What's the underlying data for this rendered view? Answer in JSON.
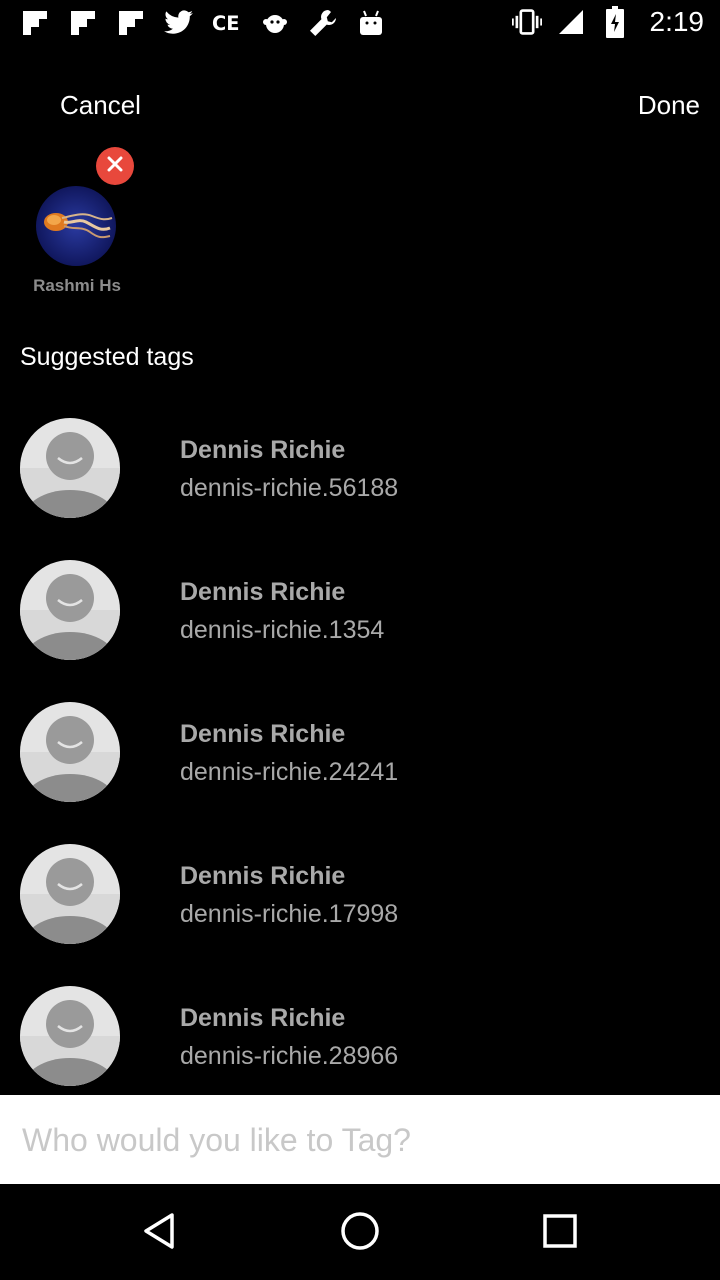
{
  "status_bar": {
    "time": "2:19",
    "left_icons": [
      "flipboard-icon",
      "flipboard-icon",
      "flipboard-icon",
      "twitter-icon",
      "ce-icon",
      "monkey-icon",
      "wrench-icon",
      "android-icon"
    ],
    "right_icons": [
      "vibrate-icon",
      "signal-icon",
      "battery-icon"
    ]
  },
  "header": {
    "cancel_label": "Cancel",
    "done_label": "Done"
  },
  "selected": {
    "name": "Rashmi Hs"
  },
  "section_title": "Suggested tags",
  "suggestions": [
    {
      "name": "Dennis Richie",
      "handle": "dennis-richie.56188"
    },
    {
      "name": "Dennis Richie",
      "handle": "dennis-richie.1354"
    },
    {
      "name": "Dennis Richie",
      "handle": "dennis-richie.24241"
    },
    {
      "name": "Dennis Richie",
      "handle": "dennis-richie.17998"
    },
    {
      "name": "Dennis Richie",
      "handle": "dennis-richie.28966"
    }
  ],
  "search": {
    "placeholder": "Who would you like to Tag?",
    "value": ""
  },
  "colors": {
    "remove_badge": "#e8483c",
    "muted_text": "#a9a9a9",
    "background": "#000000"
  }
}
